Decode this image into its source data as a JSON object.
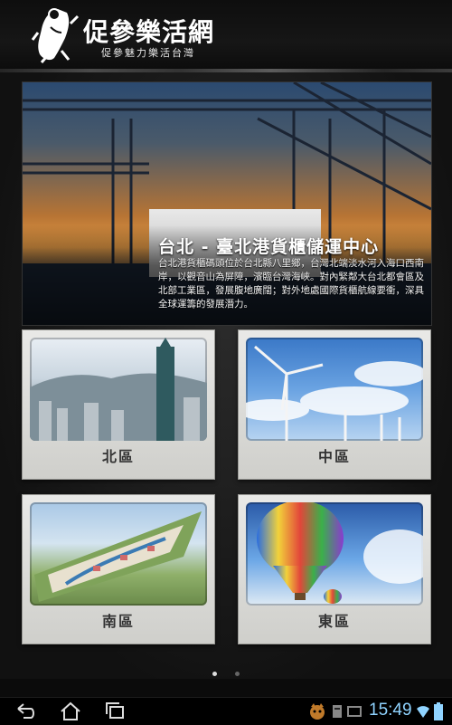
{
  "header": {
    "title": "促參樂活網",
    "subtitle": "促參魅力樂活台灣"
  },
  "banner": {
    "title": "台北 - 臺北港貨櫃儲運中心",
    "description": "台北港貨櫃碼頭位於台北縣八里鄉，台灣北端淡水河入海口西南岸，以觀音山為屏障，濱臨台灣海峽。對內緊鄰大台北都會區及北部工業區，發展腹地廣闊；對外地處國際貨櫃航線要衝，深具全球運籌的發展潛力。"
  },
  "regions": [
    {
      "label": "北區"
    },
    {
      "label": "中區"
    },
    {
      "label": "南區"
    },
    {
      "label": "東區"
    }
  ],
  "pager": {
    "total": 2,
    "active": 1
  },
  "status_bar": {
    "time": "15:49"
  },
  "icons": {
    "logo": "taiwan-figure-logo-icon",
    "back": "back-icon",
    "home": "home-icon",
    "recent": "recent-apps-icon",
    "notification": "notification-icon",
    "wifi": "wifi-icon",
    "battery": "battery-icon"
  },
  "colors": {
    "background": "#0b0b0b",
    "card": "#e3e3e0",
    "clock": "#8fd3ff"
  }
}
